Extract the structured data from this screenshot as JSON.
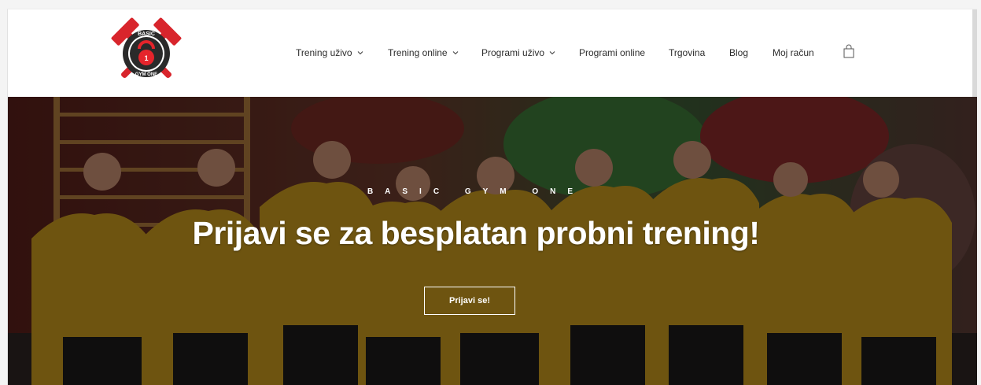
{
  "brand": {
    "logo_text_top": "BASIC",
    "logo_text_bottom": "GYM ONE",
    "logo_colors": {
      "accent": "#d8252c",
      "ring": "#2a2a2a",
      "kettlebell": "#e5242b"
    }
  },
  "nav": {
    "items": [
      {
        "label": "Trening uživo",
        "has_dropdown": true
      },
      {
        "label": "Trening online",
        "has_dropdown": true
      },
      {
        "label": "Programi uživo",
        "has_dropdown": true
      },
      {
        "label": "Programi online",
        "has_dropdown": false
      },
      {
        "label": "Trgovina",
        "has_dropdown": false
      },
      {
        "label": "Blog",
        "has_dropdown": false
      },
      {
        "label": "Moj račun",
        "has_dropdown": false
      }
    ],
    "cart_icon": "shopping-bag-icon"
  },
  "hero": {
    "eyebrow": "BASIC GYM ONE",
    "title": "Prijavi se za besplatan probni trening!",
    "button_label": "Prijavi se!",
    "hoodie_color": "#c99a1e",
    "overlay_color": "#000000"
  }
}
